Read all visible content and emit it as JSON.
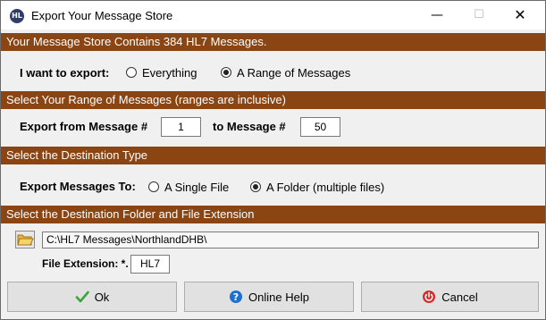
{
  "window": {
    "title": "Export Your Message Store",
    "app_icon_text": "HL",
    "minimize_glyph": "—",
    "maximize_glyph": "☐",
    "close_glyph": "✕"
  },
  "banner": {
    "store_info": "Your Message Store Contains 384 HL7 Messages."
  },
  "export_choice": {
    "label": "I want to export:",
    "options": [
      {
        "label": "Everything",
        "selected": false
      },
      {
        "label": "A Range of Messages",
        "selected": true
      }
    ]
  },
  "range": {
    "header": "Select Your Range of Messages (ranges are inclusive)",
    "from_label": "Export from Message #",
    "from_value": "1",
    "to_label": "to Message #",
    "to_value": "50"
  },
  "destination": {
    "header": "Select the Destination Type",
    "label": "Export Messages To:",
    "options": [
      {
        "label": "A Single File",
        "selected": false
      },
      {
        "label": "A Folder (multiple files)",
        "selected": true
      }
    ]
  },
  "folder": {
    "header": "Select the Destination Folder and File Extension",
    "path": "C:\\HL7 Messages\\NorthlandDHB\\",
    "ext_label": "File Extension:  *.",
    "ext_value": "HL7"
  },
  "buttons": {
    "ok": "Ok",
    "help": "Online Help",
    "cancel": "Cancel"
  },
  "colors": {
    "band": "#8b4513",
    "ok_check": "#3aa63a",
    "help_icon": "#1e6fd0",
    "cancel_icon": "#d62b2b",
    "folder_icon": "#e8b53a"
  }
}
